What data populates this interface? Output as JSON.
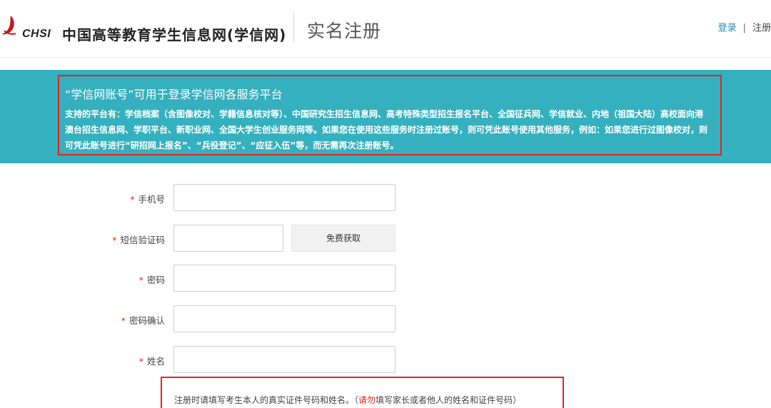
{
  "header": {
    "logo_text": "CHSI",
    "site_name": "中国高等教育学生信息网(学信网)",
    "page_title": "实名注册",
    "login_link": "登录",
    "separator": "|",
    "register_link": "注册"
  },
  "banner": {
    "title": "“学信网账号”可用于登录学信网各服务平台",
    "body": "支持的平台有：学信档案（含图像校对、学籍信息核对等）、中国研究生招生信息网、高考特殊类型招生报名平台、全国征兵网、学信就业、内地（祖国大陆）高校面向港澳台招生信息网、学职平台、新职业网、全国大学生创业服务网等。如果您在使用这些服务时注册过账号，则可凭此账号使用其他服务，例如：如果您进行过图像校对，则可凭此账号进行“研招网上报名”、“兵役登记”、“应征入伍”等，而无需再次注册账号。"
  },
  "form": {
    "required_mark": "*",
    "phone_label": "手机号",
    "phone_value": "",
    "sms_label": "短信验证码",
    "sms_value": "",
    "sms_button": "免费获取",
    "password_label": "密码",
    "password_value": "",
    "confirm_label": "密码确认",
    "confirm_value": "",
    "name_label": "姓名",
    "name_value": ""
  },
  "notice": {
    "part1": "注册时请填写考生本人的真实证件号码和姓名。（",
    "warn": "请勿",
    "part2": "填写家长或者他人的姓名和证件号码）"
  },
  "colors": {
    "banner_bg": "#35b0be",
    "highlight_border": "#e0261f",
    "link": "#2a8ab8"
  }
}
